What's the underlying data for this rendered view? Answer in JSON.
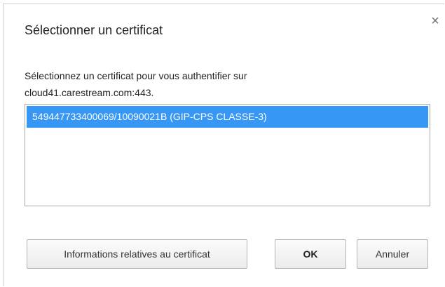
{
  "dialog": {
    "title": "Sélectionner un certificat",
    "close_glyph": "×",
    "description": "Sélectionnez un certificat pour vous authentifier sur cloud41.carestream.com:443."
  },
  "certificates": [
    {
      "label": "549447733400069/10090021B (GIP-CPS CLASSE-3)",
      "selected": true
    }
  ],
  "buttons": {
    "info": "Informations relatives au certificat",
    "ok": "OK",
    "cancel": "Annuler"
  },
  "colors": {
    "selection": "#3797f5",
    "border": "#a9a9a9"
  },
  "icons": {
    "close": "close-icon"
  }
}
